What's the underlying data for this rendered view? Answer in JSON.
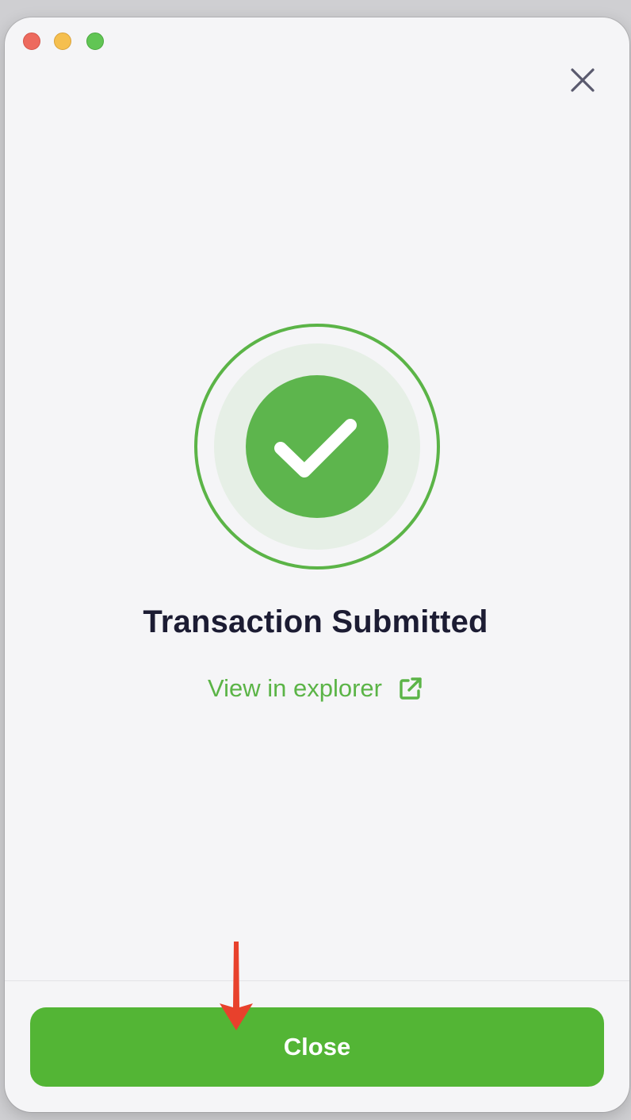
{
  "window": {
    "traffic_lights": [
      "close",
      "minimize",
      "zoom"
    ]
  },
  "dialog": {
    "close_icon": "close-icon",
    "status_icon": "checkmark-circle-icon",
    "title": "Transaction Submitted",
    "explorer_link": "View in explorer",
    "explorer_icon": "external-link-icon",
    "close_button": "Close"
  },
  "colors": {
    "accent_green": "#53b535",
    "link_green": "#5bb447",
    "title": "#1c1c33",
    "annotation_arrow": "#e8412c"
  }
}
